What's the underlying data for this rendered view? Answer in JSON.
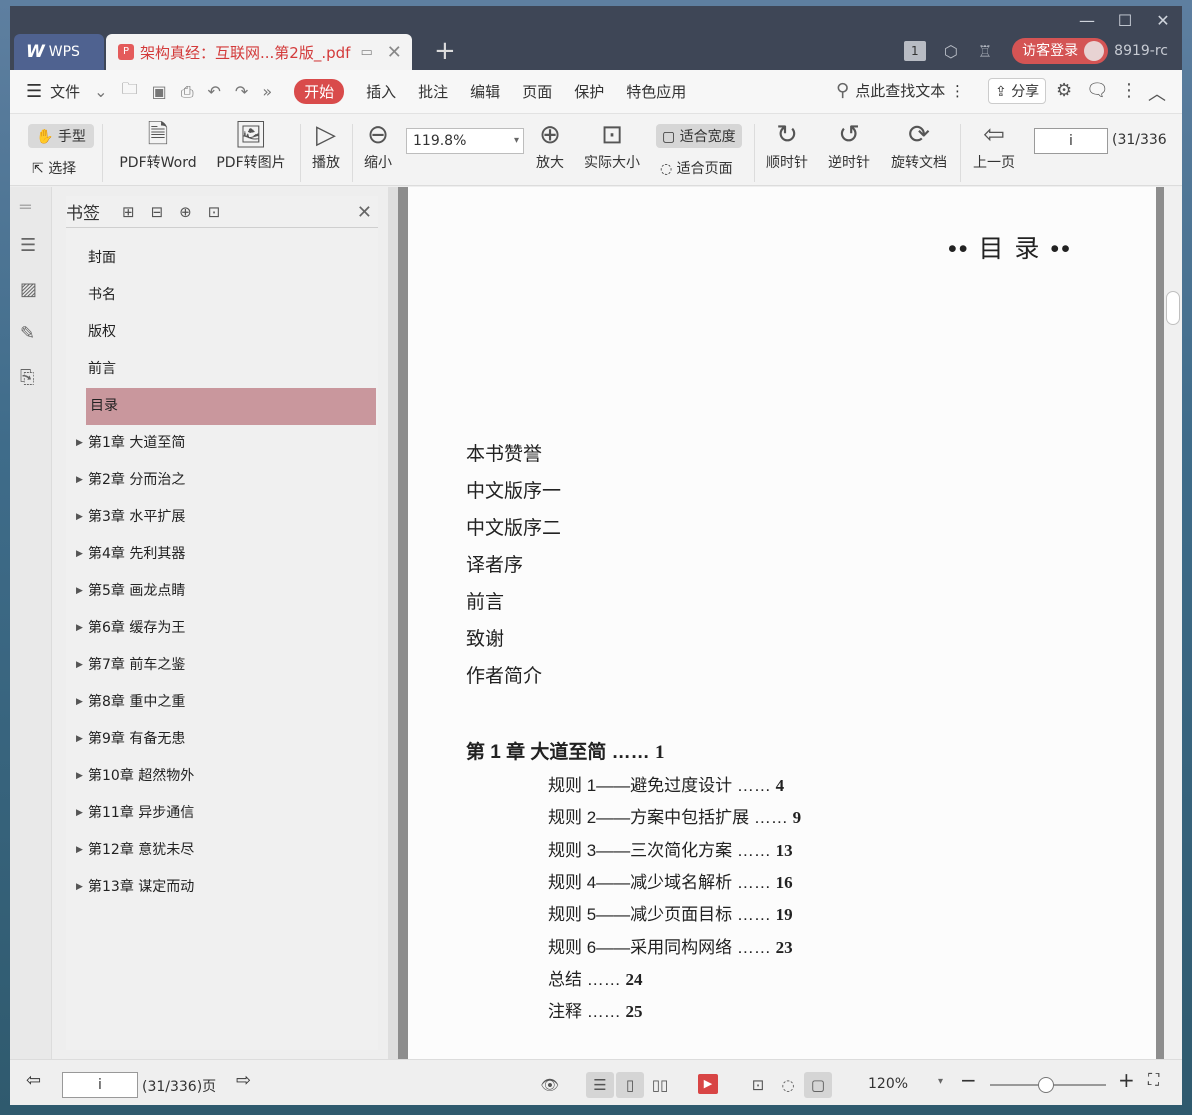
{
  "titlebar": {
    "wps_tab": "WPS",
    "doc_tab": "架构真经：互联网...第2版_.pdf",
    "tab_count": "1",
    "login_button": "访客登录",
    "account": "8919-rc"
  },
  "menubar": {
    "file": "文件",
    "tabs": [
      "开始",
      "插入",
      "批注",
      "编辑",
      "页面",
      "保护",
      "特色应用"
    ],
    "search": "点此查找文本",
    "share": "分享"
  },
  "toolbar": {
    "hand": "手型",
    "select": "选择",
    "pdf_to_word": "PDF转Word",
    "pdf_to_image": "PDF转图片",
    "play": "播放",
    "zoom_out": "缩小",
    "zoom_value": "119.8%",
    "zoom_in": "放大",
    "actual_size": "实际大小",
    "fit_width": "适合宽度",
    "fit_page": "适合页面",
    "rotate_cw": "顺时针",
    "rotate_ccw": "逆时针",
    "rotate_doc": "旋转文档",
    "prev_page": "上一页",
    "page_input": "i",
    "page_count": "(31/336"
  },
  "bookmarks": {
    "title": "书签",
    "items": [
      {
        "label": "封面",
        "expandable": false
      },
      {
        "label": "书名",
        "expandable": false
      },
      {
        "label": "版权",
        "expandable": false
      },
      {
        "label": "前言",
        "expandable": false
      },
      {
        "label": "目录",
        "expandable": false,
        "selected": true
      },
      {
        "label": "第1章  大道至简",
        "expandable": true
      },
      {
        "label": "第2章  分而治之",
        "expandable": true
      },
      {
        "label": "第3章  水平扩展",
        "expandable": true
      },
      {
        "label": "第4章  先利其器",
        "expandable": true
      },
      {
        "label": "第5章  画龙点睛",
        "expandable": true
      },
      {
        "label": "第6章  缓存为王",
        "expandable": true
      },
      {
        "label": "第7章  前车之鉴",
        "expandable": true
      },
      {
        "label": "第8章  重中之重",
        "expandable": true
      },
      {
        "label": "第9章  有备无患",
        "expandable": true
      },
      {
        "label": "第10章  超然物外",
        "expandable": true
      },
      {
        "label": "第11章  异步通信",
        "expandable": true
      },
      {
        "label": "第12章  意犹未尽",
        "expandable": true
      },
      {
        "label": "第13章  谋定而动",
        "expandable": true
      }
    ]
  },
  "document": {
    "title": "•• 目  录 ••",
    "front_matter": [
      "本书赞誉",
      "中文版序一",
      "中文版序二",
      "译者序",
      "前言",
      "致谢",
      "作者简介"
    ],
    "chapter": {
      "label": "第 1 章   大道至简 ……",
      "page": "1"
    },
    "rules": [
      {
        "text": "规则 1——避免过度设计 ……",
        "page": "4"
      },
      {
        "text": "规则 2——方案中包括扩展 ……",
        "page": "9"
      },
      {
        "text": "规则 3——三次简化方案 ……",
        "page": "13"
      },
      {
        "text": "规则 4——减少域名解析 ……",
        "page": "16"
      },
      {
        "text": "规则 5——减少页面目标 ……",
        "page": "19"
      },
      {
        "text": "规则 6——采用同构网络 ……",
        "page": "23"
      },
      {
        "text": "总结 ……",
        "page": "24"
      },
      {
        "text": "注释 ……",
        "page": "25"
      }
    ]
  },
  "statusbar": {
    "page_input": "i",
    "page_count": "(31/336)页",
    "zoom": "120%"
  }
}
